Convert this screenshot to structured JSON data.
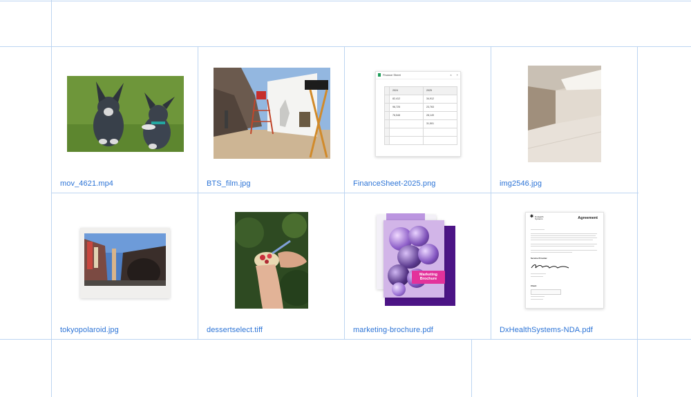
{
  "files": [
    {
      "name": "mov_4621.mp4"
    },
    {
      "name": "BTS_film.jpg"
    },
    {
      "name": "FinanceSheet-2025.png"
    },
    {
      "name": "img2546.jpg"
    },
    {
      "name": "tokyopolaroid.jpg"
    },
    {
      "name": "dessertselect.tiff"
    },
    {
      "name": "marketing-brochure.pdf"
    },
    {
      "name": "DxHealthSystems-NDA.pdf"
    }
  ],
  "finance_sheet": {
    "tab_title": "Finance Sheet",
    "close_symbol": "×",
    "add_symbol": "+",
    "headers": [
      "2024",
      "2025"
    ],
    "rows": [
      [
        "82,412",
        "34,912"
      ],
      [
        "96,725",
        "23,763"
      ],
      [
        "76,548",
        "28,149"
      ],
      [
        "",
        "31,501"
      ]
    ]
  },
  "nda_doc": {
    "logo_text": "DxHealth Systems",
    "title": "Agreement",
    "service_provider_label": "Service Provider",
    "client_label": "Client"
  },
  "brochure": {
    "label_line1": "Marketing",
    "label_line2": "Brochure"
  },
  "colors": {
    "gridline": "#bcd4f1",
    "caption": "#2b73d6"
  }
}
